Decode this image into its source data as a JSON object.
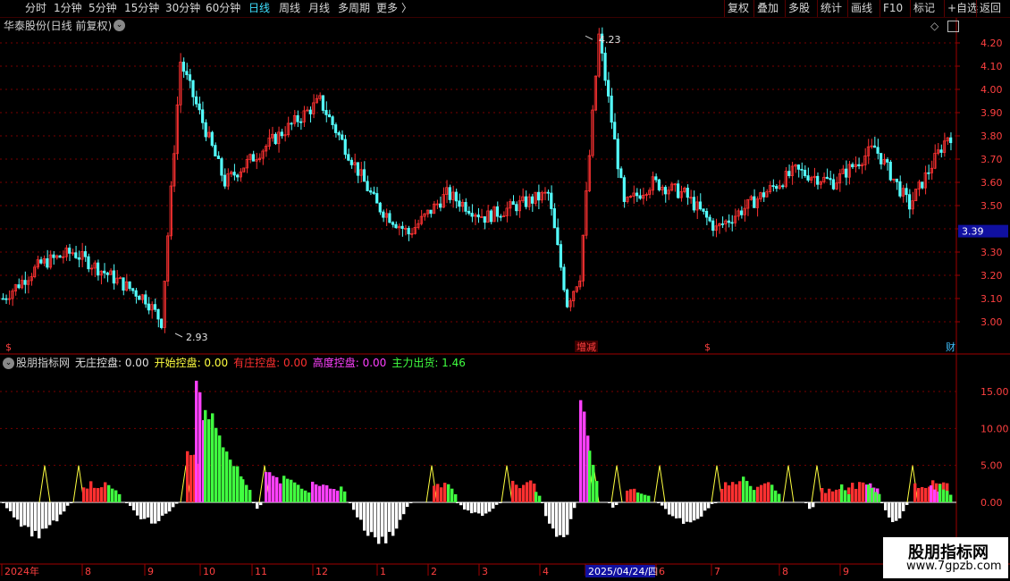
{
  "toolbar": {
    "periods": [
      "分时",
      "1分钟",
      "5分钟",
      "15分钟",
      "30分钟",
      "60分钟",
      "日线",
      "周线",
      "月线",
      "多周期",
      "更多"
    ],
    "active_period": "日线",
    "more_icon": "chevron-right-icon",
    "actions": [
      "复权",
      "叠加",
      "多股",
      "统计",
      "画线",
      "F10",
      "标记",
      "+自选",
      "返回"
    ]
  },
  "main_chart": {
    "title": "华泰股份(日线 前复权)",
    "high_marker": "4.23",
    "low_marker": "2.93",
    "current_price": "3.39",
    "events": [
      "$",
      "增减",
      "$",
      "财"
    ],
    "y_ticks": [
      "4.20",
      "4.10",
      "4.00",
      "3.90",
      "3.80",
      "3.70",
      "3.60",
      "3.50",
      "3.40",
      "3.30",
      "3.20",
      "3.10",
      "3.00"
    ]
  },
  "indicator": {
    "name": "股朋指标网",
    "values": [
      {
        "label": "无庄控盘:",
        "value": "0.00",
        "color": "#e0e0e0"
      },
      {
        "label": "开始控盘:",
        "value": "0.00",
        "color": "#ffff40"
      },
      {
        "label": "有庄控盘:",
        "value": "0.00",
        "color": "#ff3030"
      },
      {
        "label": "高度控盘:",
        "value": "0.00",
        "color": "#ff40ff"
      },
      {
        "label": "主力出货:",
        "value": "1.46",
        "color": "#40ff40"
      }
    ],
    "y_ticks": [
      "15.00",
      "10.00",
      "5.00",
      "0.00"
    ]
  },
  "x_axis": {
    "labels": [
      "2024年",
      "8",
      "9",
      "10",
      "11",
      "12",
      "1",
      "2",
      "3",
      "4",
      "2025/04/24/四",
      "6",
      "7",
      "8",
      "9"
    ]
  },
  "watermark": {
    "line1": "股朋指标网",
    "line2": "www.7gpzb.com"
  },
  "colors": {
    "up": "#ff3232",
    "down": "#54ffff",
    "grid": "#7a0000",
    "axis": "#a00000"
  },
  "chart_data": [
    {
      "type": "candlestick",
      "title": "华泰股份(日线 前复权)",
      "ylim": [
        2.9,
        4.25
      ],
      "x": [
        "2024-07",
        "2024-08",
        "2024-09",
        "2024-10",
        "2024-11",
        "2024-12",
        "2025-01",
        "2025-02",
        "2025-03",
        "2025-04",
        "2025-05",
        "2025-06",
        "2025-07",
        "2025-08",
        "2025-09"
      ],
      "series": [
        {
          "approx_close": [
            3.15,
            3.25,
            3.26,
            3.04,
            3.6,
            3.8,
            3.72,
            3.97,
            3.7,
            3.54,
            3.41,
            3.47,
            3.55,
            3.43,
            3.47,
            3.55,
            3.47,
            3.55,
            3.65,
            3.75,
            3.72
          ],
          "note_points": [
            [
              0,
              3.1
            ],
            [
              12,
              3.25
            ],
            [
              22,
              3.3
            ],
            [
              45,
              3.1
            ],
            [
              50,
              3.0
            ],
            [
              56,
              4.12
            ],
            [
              70,
              3.6
            ],
            [
              85,
              3.78
            ],
            [
              100,
              3.95
            ],
            [
              110,
              3.7
            ],
            [
              118,
              3.5
            ],
            [
              128,
              3.38
            ],
            [
              140,
              3.55
            ],
            [
              152,
              3.45
            ],
            [
              162,
              3.5
            ],
            [
              172,
              3.55
            ],
            [
              178,
              3.08
            ],
            [
              182,
              3.2
            ],
            [
              188,
              4.23
            ],
            [
              196,
              3.5
            ],
            [
              205,
              3.6
            ],
            [
              215,
              3.55
            ],
            [
              225,
              3.4
            ],
            [
              240,
              3.55
            ],
            [
              250,
              3.65
            ],
            [
              262,
              3.6
            ],
            [
              275,
              3.75
            ],
            [
              286,
              3.5
            ],
            [
              298,
              3.8
            ]
          ]
        }
      ]
    },
    {
      "type": "bar",
      "title": "股朋指标网",
      "ylim": [
        -6,
        19
      ],
      "series": [
        {
          "name": "无庄控盘",
          "color": "#ffffff",
          "peaks": [
            -5,
            -1.5,
            -2.5,
            -2,
            -3,
            -5,
            -4,
            -2,
            -6,
            -2,
            -3,
            -1,
            -1,
            -2,
            -3
          ]
        },
        {
          "name": "开始控盘",
          "color": "#ffff40",
          "peaks": [
            5,
            5,
            5,
            5,
            5,
            5,
            5,
            5,
            5,
            5,
            5,
            5,
            5,
            5,
            5,
            5
          ]
        },
        {
          "name": "有庄控盘",
          "color": "#ff3030",
          "peaks": [
            3,
            3,
            3,
            3,
            3,
            3,
            3,
            3,
            3,
            2,
            3,
            3,
            3,
            2,
            2
          ]
        },
        {
          "name": "高度控盘",
          "color": "#ff40ff",
          "peaks": [
            18,
            5,
            3,
            15,
            2
          ]
        },
        {
          "name": "主力出货",
          "color": "#40ff40",
          "peaks": [
            14,
            4,
            3,
            10,
            3,
            3,
            3,
            3,
            3,
            2
          ]
        }
      ]
    }
  ]
}
